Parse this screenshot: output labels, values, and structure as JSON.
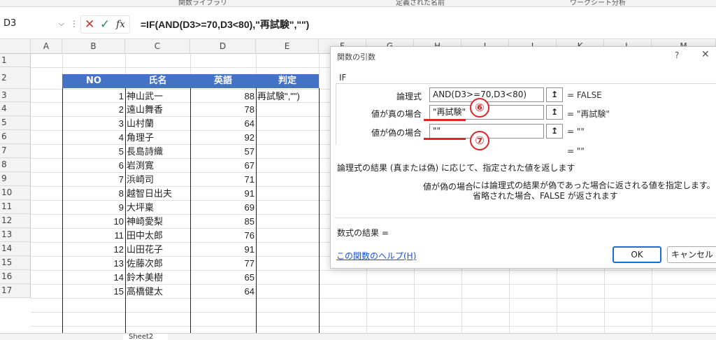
{
  "ribbon": {
    "group1": "関数ライブラリ",
    "group2": "定義された名前",
    "group3": "ワークシート分析"
  },
  "formula_bar": {
    "name_box": "D3",
    "formula_prefix": "=IF(AND(D3>=70,D3<80),",
    "formula_arg": "\"再試験\",\"\")",
    "cancel_symbol": "✕",
    "enter_symbol": "✓",
    "fx_symbol": "fx"
  },
  "columns": [
    "A",
    "B",
    "C",
    "D",
    "E",
    "F",
    "G",
    "H",
    "I",
    "J",
    "K",
    "L",
    "M"
  ],
  "rows": [
    "1",
    "2",
    "3",
    "4",
    "5",
    "6",
    "7",
    "8",
    "9",
    "10",
    "11",
    "12",
    "13",
    "14",
    "15",
    "16",
    "17"
  ],
  "table": {
    "headers": [
      "NO",
      "氏名",
      "英語",
      "判定"
    ],
    "colors": {
      "header_bg": "#4472c4",
      "header_text": "#ffffff"
    },
    "records": [
      {
        "no": "1",
        "name": "神山武一",
        "score": "88",
        "judge": "再試験\",\"\")"
      },
      {
        "no": "2",
        "name": "遠山舞香",
        "score": "78",
        "judge": ""
      },
      {
        "no": "3",
        "name": "山村蘭",
        "score": "64",
        "judge": ""
      },
      {
        "no": "4",
        "name": "角理子",
        "score": "92",
        "judge": ""
      },
      {
        "no": "5",
        "name": "長島詩織",
        "score": "57",
        "judge": ""
      },
      {
        "no": "6",
        "name": "岩渕寛",
        "score": "67",
        "judge": ""
      },
      {
        "no": "7",
        "name": "浜崎司",
        "score": "71",
        "judge": ""
      },
      {
        "no": "8",
        "name": "越智日出夫",
        "score": "91",
        "judge": ""
      },
      {
        "no": "9",
        "name": "大坪稟",
        "score": "69",
        "judge": ""
      },
      {
        "no": "10",
        "name": "神崎愛梨",
        "score": "85",
        "judge": ""
      },
      {
        "no": "11",
        "name": "田中太郎",
        "score": "76",
        "judge": ""
      },
      {
        "no": "12",
        "name": "山田花子",
        "score": "91",
        "judge": ""
      },
      {
        "no": "13",
        "name": "佐藤次郎",
        "score": "77",
        "judge": ""
      },
      {
        "no": "14",
        "name": "鈴木美樹",
        "score": "65",
        "judge": ""
      },
      {
        "no": "15",
        "name": "高橋健太",
        "score": "64",
        "judge": ""
      }
    ]
  },
  "dialog": {
    "title": "関数の引数",
    "help_symbol": "?",
    "close_symbol": "✕",
    "function_name": "IF",
    "args": [
      {
        "label": "論理式",
        "value": "AND(D3>=70,D3<80)",
        "result": "=  FALSE"
      },
      {
        "label": "値が真の場合",
        "value": "\"再試験\"",
        "result": "=  \"再試験\""
      },
      {
        "label": "値が偽の場合",
        "value": "\"\"",
        "result": "=  \"\""
      }
    ],
    "overall_result": "=  \"\"",
    "description": "論理式の結果 (真または偽) に応じて、指定された値を返します",
    "arg_desc_name": "値が偽の場合",
    "arg_desc_text": "には論理式の結果が偽であった場合に返される値を指定します。省略された場合、FALSE が返されます",
    "formula_result_label": "数式の結果 =",
    "help_link": "この関数のヘルプ(H)",
    "ok_label": "OK",
    "cancel_label": "キャンセル",
    "collapse_symbol": "↥"
  },
  "annotations": {
    "callout6": "⑥",
    "callout7": "⑦",
    "color": "#e0242a"
  },
  "sheet_tab": "Sheet2"
}
